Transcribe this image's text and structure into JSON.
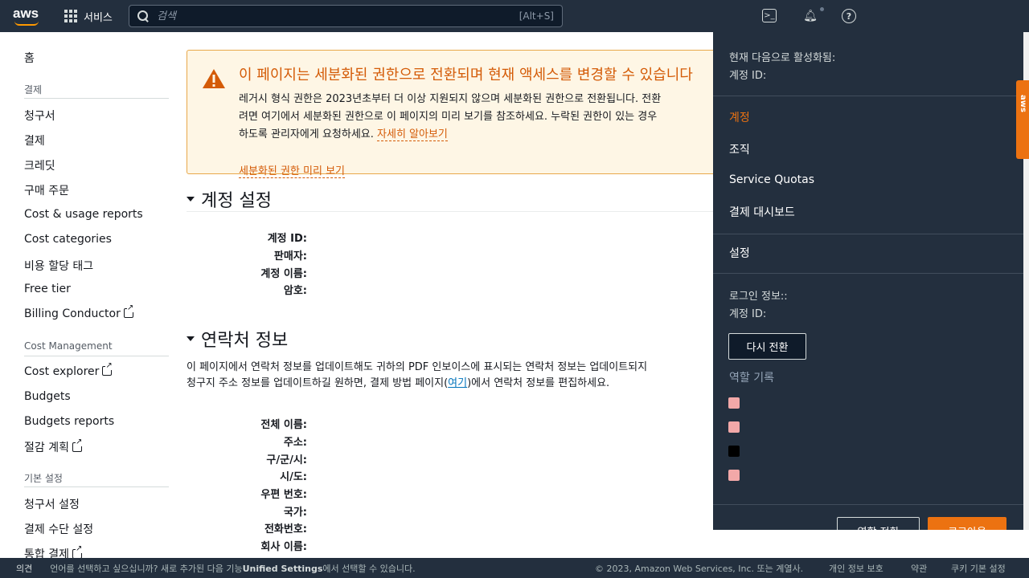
{
  "topnav": {
    "logo": "aws",
    "services_label": "서비스",
    "search_placeholder": "검색",
    "search_shortcut": "[Alt+S]",
    "icons": [
      "cloudshell-icon",
      "bell-icon",
      "help-icon"
    ]
  },
  "sidebar": {
    "home": "홈",
    "sections": [
      {
        "title": "결제",
        "items": [
          "청구서",
          "결제",
          "크레딧",
          "구매 주문",
          "Cost & usage reports",
          "Cost categories",
          "비용 할당 태그",
          "Free tier",
          "Billing Conductor"
        ]
      },
      {
        "title": "Cost Management",
        "items": [
          "Cost explorer",
          "Budgets",
          "Budgets reports",
          "절감 계획"
        ]
      },
      {
        "title": "기본 설정",
        "items": [
          "청구서 설정",
          "결제 수단 설정",
          "통합 결제"
        ]
      }
    ]
  },
  "alert": {
    "title": "이 페이지는 세분화된 권한으로 전환되며 현재 액세스를 변경할 수 있습니다",
    "line1": "레거시 형식 권한은 2023년초부터 더 이상 지원되지 않으며 세분화된 권한으로 전환됩니다. 전환",
    "line2": "려면 여기에서 세분화된 권한으로 이 페이지의 미리 보기를 참조하세요. 누락된 권한이 있는 경우",
    "line3": "하도록 관리자에게 요청하세요.",
    "learn_more": "자세히 알아보기",
    "preview_link": "세분화된 권한 미리 보기"
  },
  "account_settings": {
    "heading": "계정 설정",
    "fields": [
      "계정 ID:",
      "판매자:",
      "계정 이름:",
      "암호:"
    ]
  },
  "contact_info": {
    "heading": "연락처 정보",
    "desc_line1": "이 페이지에서 연락처 정보를 업데이트해도 귀하의 PDF 인보이스에 표시되는 연락처 정보는 업데이트되지",
    "desc_line2_a": "청구지 주소 정보를 업데이트하길 원하면, 결제 방법 페이지(",
    "desc_link": "여기",
    "desc_line2_b": ")에서 연락처 정보를 편집하세요.",
    "fields": [
      "전체 이름:",
      "주소:",
      "구/군/시:",
      "시/도:",
      "우편 번호:",
      "국가:",
      "전화번호:",
      "회사 이름:"
    ]
  },
  "account_menu": {
    "active_as": "현재 다음으로 활성화됨:",
    "account_id": "계정 ID:",
    "items": [
      "계정",
      "조직",
      "Service Quotas",
      "결제 대시보드"
    ],
    "settings": "설정",
    "signed_in": "로그인 정보::",
    "signed_account_id": "계정 ID:",
    "switch_back": "다시 전환",
    "role_history": "역할 기록",
    "role_colors": [
      "#f2a8a8",
      "#f2a8a8",
      "#000000",
      "#f2a8a8"
    ],
    "switch_role": "역할 전환",
    "sign_out": "로그아웃"
  },
  "footer": {
    "feedback": "의견",
    "lang_text_a": "언어를 선택하고 싶으십니까? 새로 추가된 다음 기능",
    "lang_bold": "Unified Settings",
    "lang_text_b": "에서 선택할 수 있습니다.",
    "copyright": "© 2023, Amazon Web Services, Inc. 또는 계열사.",
    "privacy": "개인 정보 보호",
    "terms": "약관",
    "cookies": "쿠키 기본 설정"
  },
  "colors": {
    "nav_bg": "#232f3e",
    "accent": "#ec7211",
    "alert_bg": "#fef6e5",
    "link": "#0073bb"
  }
}
